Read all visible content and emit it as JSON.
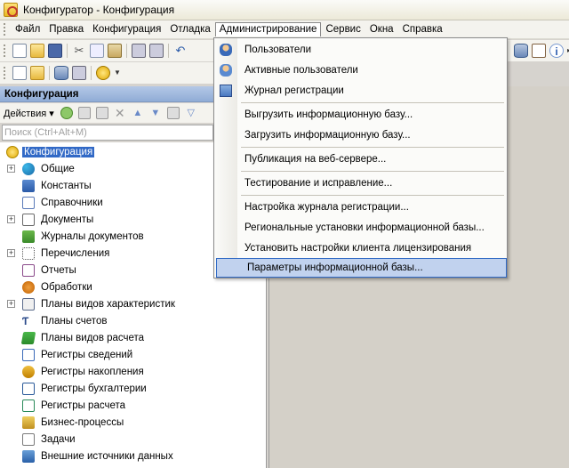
{
  "window": {
    "title": "Конфигуратор - Конфигурация"
  },
  "menubar": {
    "items": [
      "Файл",
      "Правка",
      "Конфигурация",
      "Отладка",
      "Администрирование",
      "Сервис",
      "Окна",
      "Справка"
    ]
  },
  "panel": {
    "title": "Конфигурация",
    "actions_label": "Действия",
    "search_placeholder": "Поиск (Ctrl+Alt+M)"
  },
  "tree": {
    "root": "Конфигурация",
    "items": [
      {
        "label": "Общие",
        "icon": "common-icon",
        "expandable": true
      },
      {
        "label": "Константы",
        "icon": "constants-icon",
        "expandable": false
      },
      {
        "label": "Справочники",
        "icon": "catalogs-icon",
        "expandable": false
      },
      {
        "label": "Документы",
        "icon": "documents-icon",
        "expandable": true
      },
      {
        "label": "Журналы документов",
        "icon": "document-journals-icon",
        "expandable": false
      },
      {
        "label": "Перечисления",
        "icon": "enums-icon",
        "expandable": true
      },
      {
        "label": "Отчеты",
        "icon": "reports-icon",
        "expandable": false
      },
      {
        "label": "Обработки",
        "icon": "data-processors-icon",
        "expandable": false
      },
      {
        "label": "Планы видов характеристик",
        "icon": "characteristic-types-icon",
        "expandable": true
      },
      {
        "label": "Планы счетов",
        "icon": "charts-of-accounts-icon",
        "expandable": false
      },
      {
        "label": "Планы видов расчета",
        "icon": "calculation-types-icon",
        "expandable": false
      },
      {
        "label": "Регистры сведений",
        "icon": "information-registers-icon",
        "expandable": false
      },
      {
        "label": "Регистры накопления",
        "icon": "accumulation-registers-icon",
        "expandable": false
      },
      {
        "label": "Регистры бухгалтерии",
        "icon": "accounting-registers-icon",
        "expandable": false
      },
      {
        "label": "Регистры расчета",
        "icon": "calculation-registers-icon",
        "expandable": false
      },
      {
        "label": "Бизнес-процессы",
        "icon": "business-processes-icon",
        "expandable": false
      },
      {
        "label": "Задачи",
        "icon": "tasks-icon",
        "expandable": false
      },
      {
        "label": "Внешние источники данных",
        "icon": "external-data-sources-icon",
        "expandable": false
      }
    ]
  },
  "admin_menu": {
    "items": [
      "Пользователи",
      "Активные пользователи",
      "Журнал регистрации",
      "Выгрузить информационную базу...",
      "Загрузить информационную базу...",
      "Публикация на веб-сервере...",
      "Тестирование и исправление...",
      "Настройка журнала регистрации...",
      "Региональные установки информационной базы...",
      "Установить настройки клиента лицензирования",
      "Параметры информационной базы..."
    ]
  },
  "colors": {
    "selection": "#3169c6",
    "menu_highlight": "#c1d2ee",
    "panel_header": "#90acd6"
  }
}
